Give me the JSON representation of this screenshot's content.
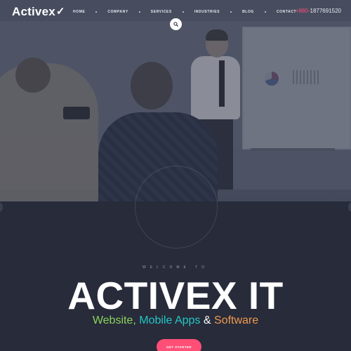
{
  "brand": {
    "logo_text": "Activex",
    "logo_mark": "✓"
  },
  "nav": {
    "items": [
      {
        "label": "HOME"
      },
      {
        "label": "COMPANY"
      },
      {
        "label": "SERVICES"
      },
      {
        "label": "INDUSTRIES"
      },
      {
        "label": "BLOG"
      },
      {
        "label": "CONTACT"
      }
    ]
  },
  "contact": {
    "phone_prefix": "+880-",
    "phone_number": "1877691520"
  },
  "search": {
    "icon": "search-icon"
  },
  "hero": {
    "welcome": "WELCOME TO",
    "title": "ACTIVEX IT",
    "tagline": {
      "part1": "Website,",
      "part2": "Mobile Apps",
      "part3": "&",
      "part4": "Software"
    },
    "cta_label": "GET STARTED"
  },
  "colors": {
    "background": "#272b3a",
    "accent": "#ff4f77",
    "tagline_green": "#8bd35b",
    "tagline_teal": "#24c7c6",
    "tagline_orange": "#f09a4e"
  }
}
